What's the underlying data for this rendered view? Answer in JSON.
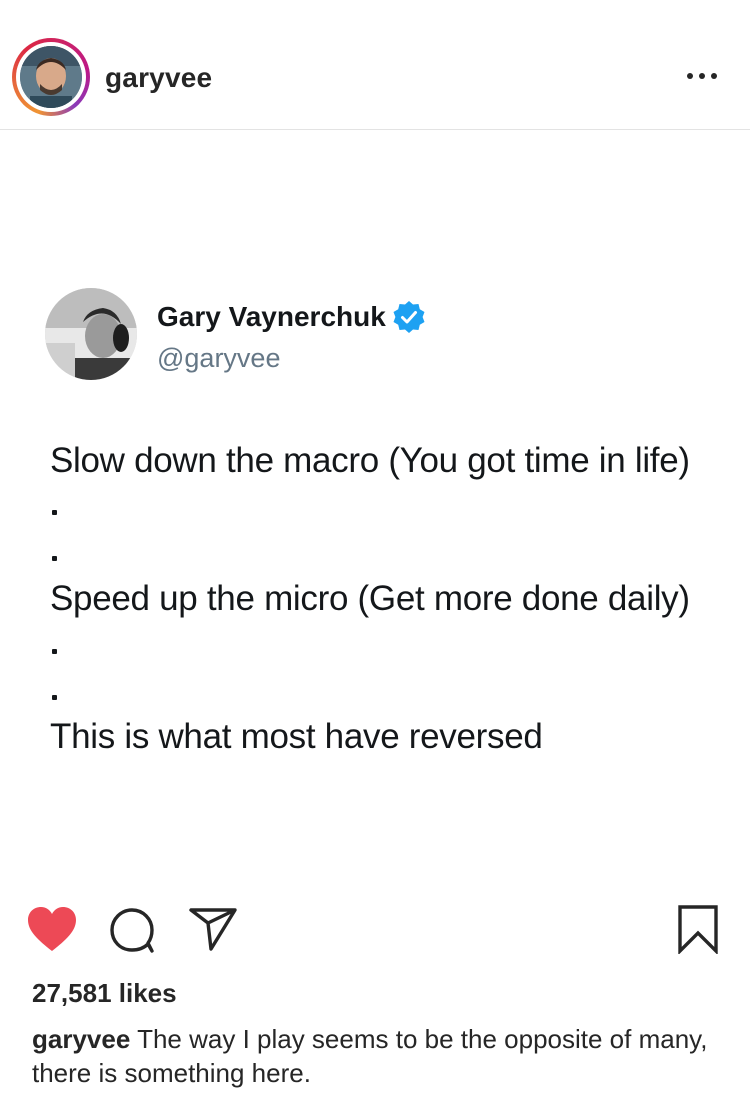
{
  "post": {
    "username": "garyvee",
    "more_label": "More options"
  },
  "tweet": {
    "display_name": "Gary Vaynerchuk",
    "handle": "@garyvee",
    "verified": true,
    "lines": [
      "Slow down the macro (You got time in life)",
      "Speed up the micro (Get more done daily)",
      "This is what most have reversed"
    ]
  },
  "actions": {
    "like_icon": "heart-filled-icon",
    "comment_icon": "comment-bubble-icon",
    "share_icon": "paper-plane-icon",
    "save_icon": "bookmark-icon"
  },
  "stats": {
    "likes": "27,581 likes"
  },
  "caption": {
    "username": "garyvee",
    "text": "The way I play seems to be the opposite of many, there is something here."
  },
  "colors": {
    "like_red": "#ed4956",
    "verified_blue": "#1da1f2",
    "text": "#262626"
  }
}
